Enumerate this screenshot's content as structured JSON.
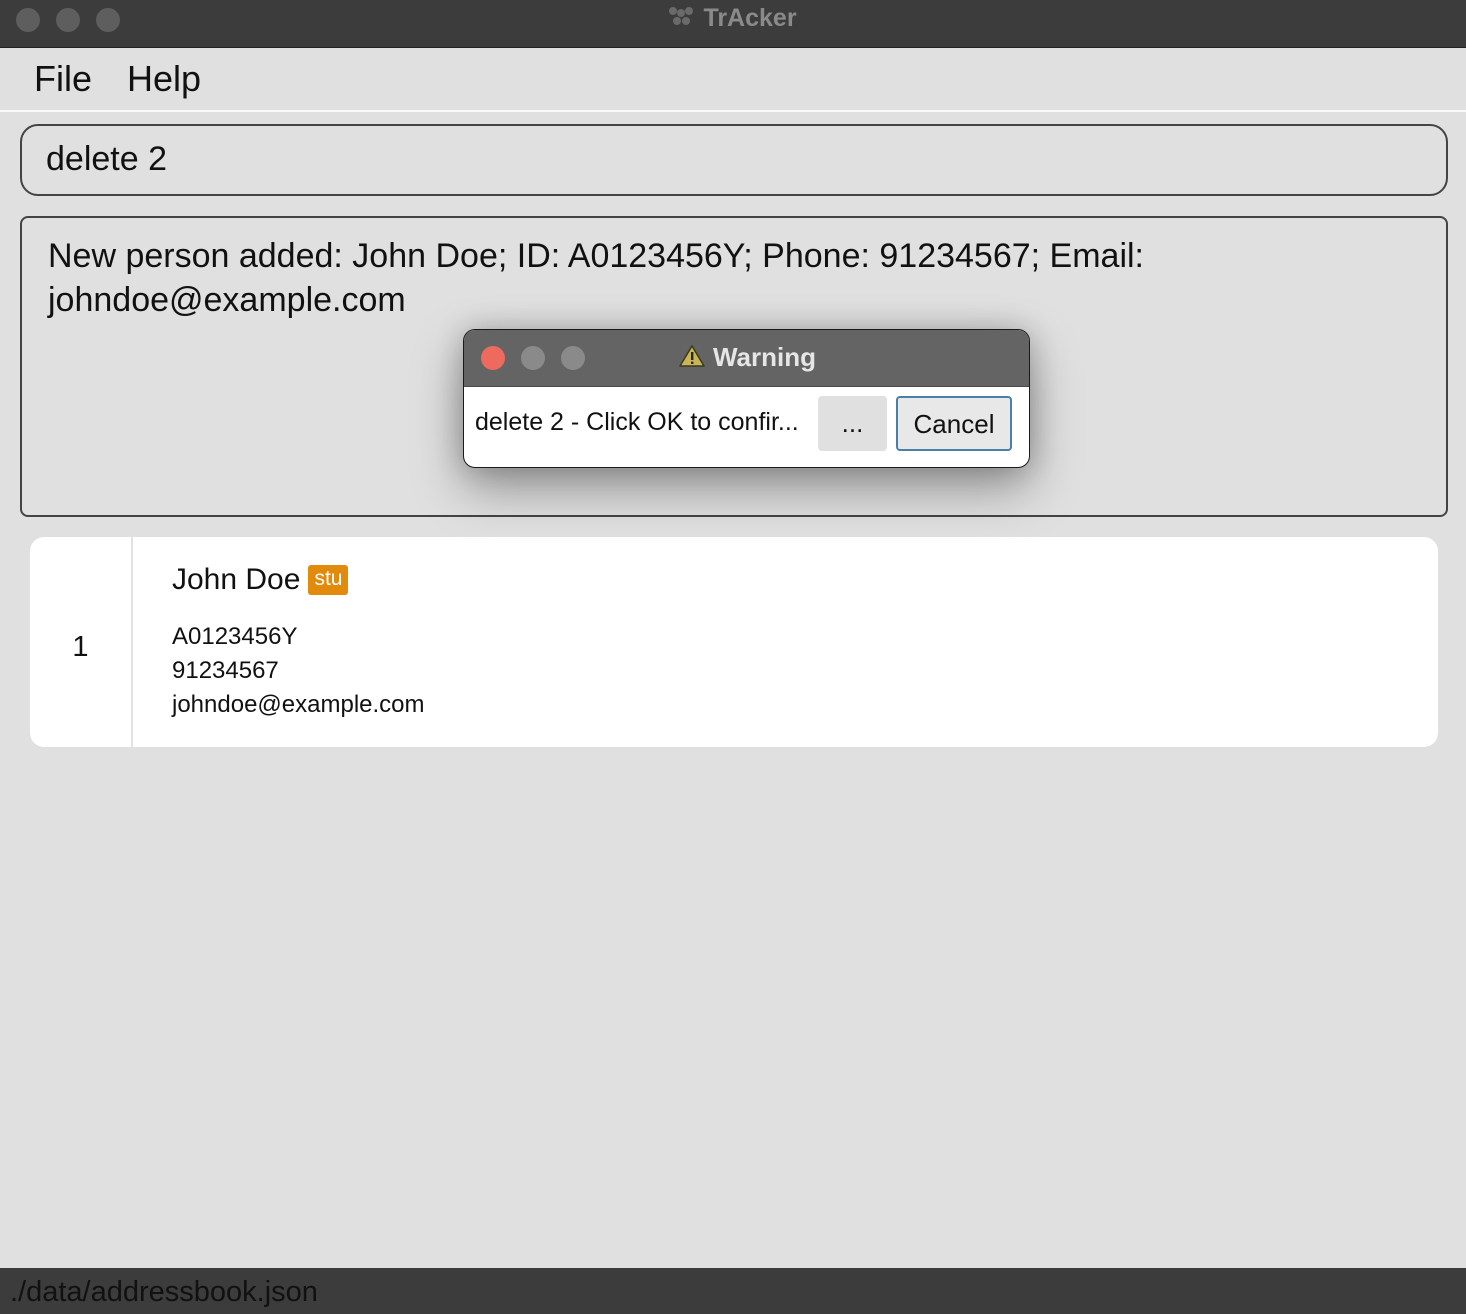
{
  "window": {
    "title": "TrAcker"
  },
  "menu": {
    "file": "File",
    "help": "Help"
  },
  "command_box": {
    "value": "delete 2"
  },
  "result_display": {
    "line1": "New person added: John Doe; ID: A0123456Y; Phone: 91234567; Email:",
    "line2": "johndoe@example.com"
  },
  "persons": [
    {
      "index": "1",
      "name": "John Doe",
      "tag": "stu",
      "id": "A0123456Y",
      "phone": "91234567",
      "email": "johndoe@example.com"
    }
  ],
  "status_bar": {
    "path": "./data/addressbook.json"
  },
  "dialog": {
    "title": "Warning",
    "message": "delete 2 - Click OK to confir...",
    "more_label": "...",
    "cancel_label": "Cancel"
  },
  "colors": {
    "titlebar": "#3c3c3c",
    "background": "#e0e0e0",
    "tag": "#e28a0c",
    "close_button": "#ee6a5f",
    "cancel_border": "#4a7fa8"
  },
  "icons": {
    "app": "app-logo-icon",
    "warning": "warning-triangle-icon"
  }
}
